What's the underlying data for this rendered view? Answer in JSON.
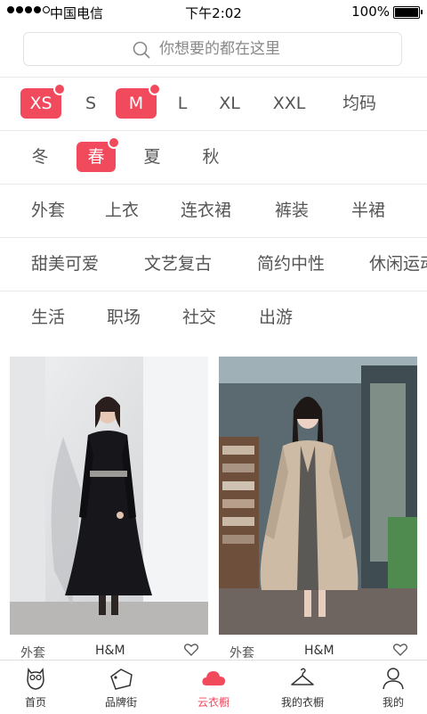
{
  "status_bar": {
    "carrier": "中国电信",
    "time": "下午2:02",
    "battery": "100%"
  },
  "search": {
    "placeholder": "你想要的都在这里"
  },
  "filters": {
    "sizes": [
      {
        "label": "XS",
        "selected": true
      },
      {
        "label": "S",
        "selected": false
      },
      {
        "label": "M",
        "selected": true
      },
      {
        "label": "L",
        "selected": false
      },
      {
        "label": "XL",
        "selected": false
      },
      {
        "label": "XXL",
        "selected": false
      },
      {
        "label": "均码",
        "selected": false
      }
    ],
    "seasons": [
      {
        "label": "冬",
        "selected": false
      },
      {
        "label": "春",
        "selected": true
      },
      {
        "label": "夏",
        "selected": false
      },
      {
        "label": "秋",
        "selected": false
      }
    ],
    "categories": [
      "外套",
      "上衣",
      "连衣裙",
      "裤装",
      "半裙"
    ],
    "styles": [
      "甜美可爱",
      "文艺复古",
      "简约中性",
      "休闲运动"
    ],
    "occasions": [
      "生活",
      "职场",
      "社交",
      "出游"
    ]
  },
  "products": [
    {
      "category": "外套",
      "brand": "H&M"
    },
    {
      "category": "外套",
      "brand": "H&M"
    }
  ],
  "tabs": [
    {
      "label": "首页",
      "icon": "owl-icon",
      "active": false
    },
    {
      "label": "品牌街",
      "icon": "brand-tag-icon",
      "active": false
    },
    {
      "label": "云衣橱",
      "icon": "cloud-icon",
      "active": true
    },
    {
      "label": "我的衣橱",
      "icon": "hanger-icon",
      "active": false
    },
    {
      "label": "我的",
      "icon": "person-icon",
      "active": false
    }
  ],
  "colors": {
    "accent": "#f24a5d",
    "text": "#555555",
    "divider": "#eaeaea"
  }
}
